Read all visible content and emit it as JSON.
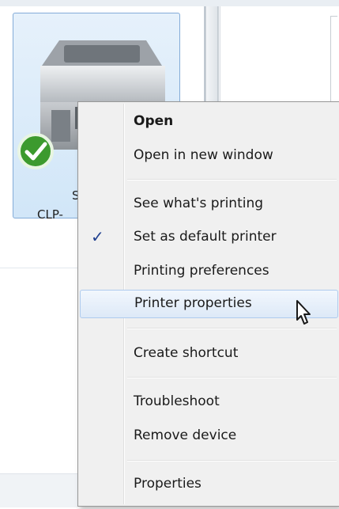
{
  "device": {
    "name_line1": "Sa",
    "name_line2": "CLP-",
    "status_icon": "default-check-icon"
  },
  "context_menu": {
    "items": [
      {
        "label": "Open",
        "bold": true
      },
      {
        "label": "Open in new window"
      },
      {
        "label": "See what's printing"
      },
      {
        "label": "Set as default printer",
        "checked": true
      },
      {
        "label": "Printing preferences"
      },
      {
        "label": "Printer properties",
        "hovered": true
      },
      {
        "label": "Create shortcut"
      },
      {
        "label": "Troubleshoot"
      },
      {
        "label": "Remove device"
      },
      {
        "label": "Properties"
      }
    ],
    "check_glyph": "✓"
  },
  "colors": {
    "selection_fill": "#d1e6f8",
    "selection_border": "#84acd8",
    "menu_bg": "#f0f0f0",
    "check": "#1f3f8f"
  }
}
